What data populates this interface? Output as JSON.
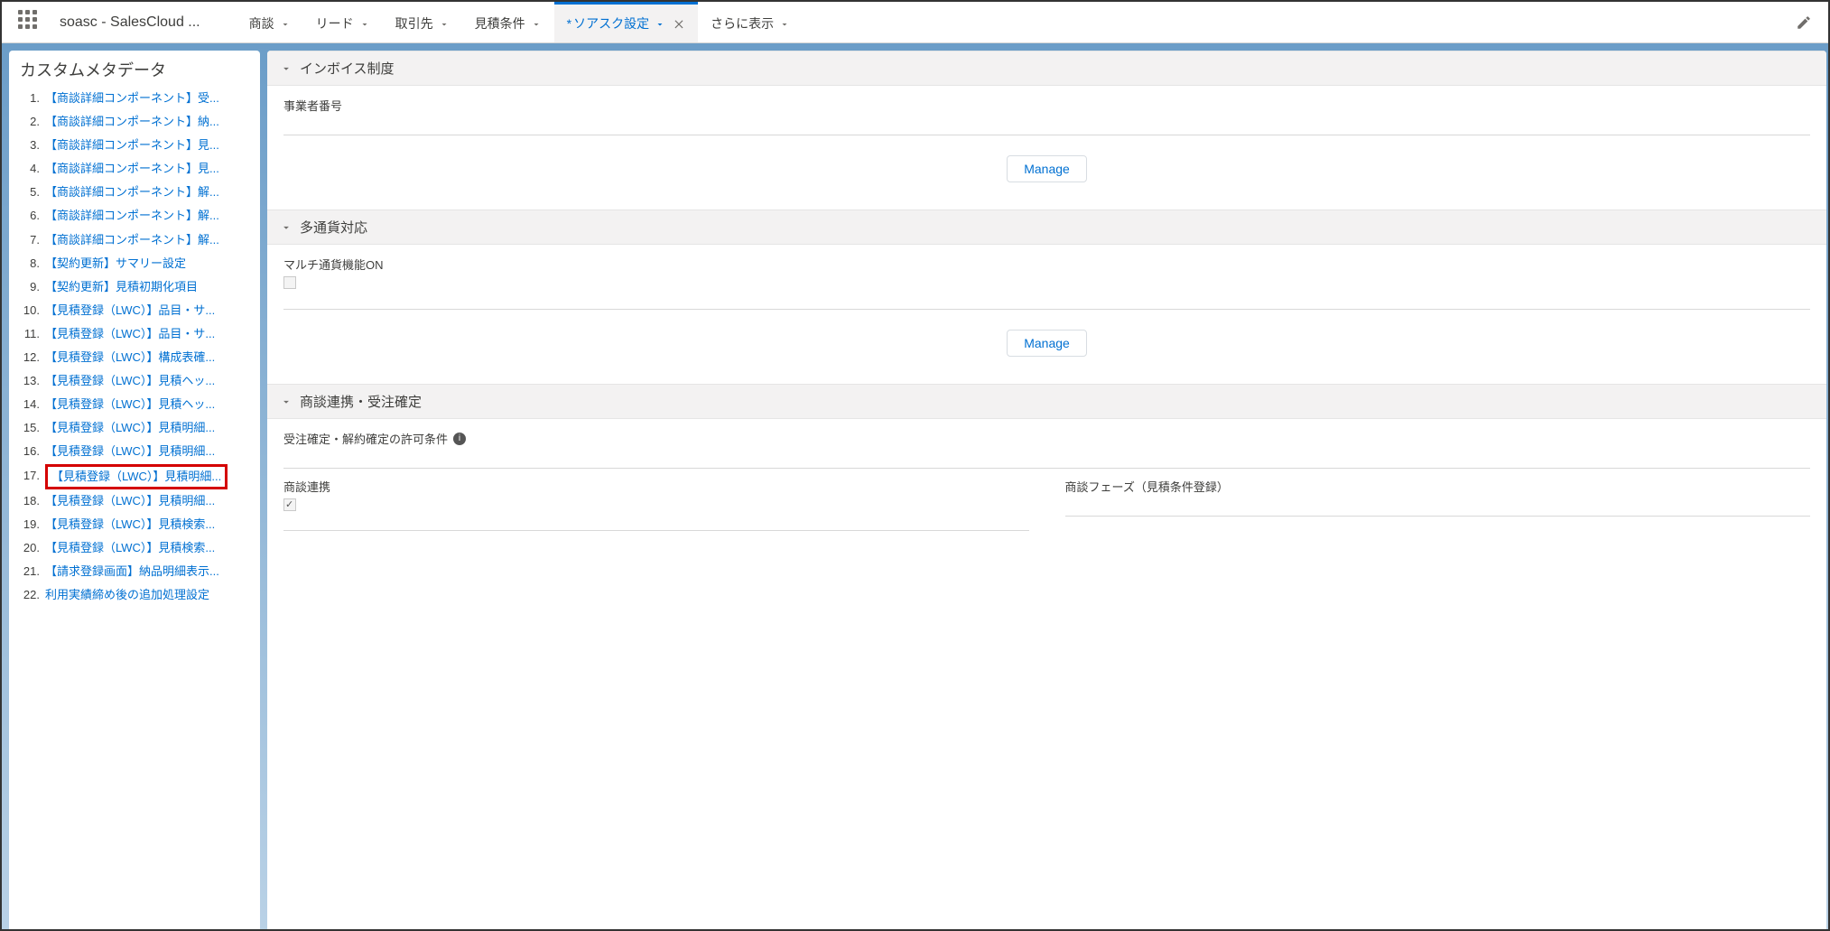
{
  "header": {
    "app_name": "soasc - SalesCloud ...",
    "tabs": [
      {
        "label": "商談"
      },
      {
        "label": "リード"
      },
      {
        "label": "取引先"
      },
      {
        "label": "見積条件"
      },
      {
        "label": "ソアスク設定",
        "active": true,
        "closable": true
      },
      {
        "label": "さらに表示",
        "more": true
      }
    ]
  },
  "sidebar": {
    "title": "カスタムメタデータ",
    "items": [
      "【商談詳細コンポーネント】受...",
      "【商談詳細コンポーネント】納...",
      "【商談詳細コンポーネント】見...",
      "【商談詳細コンポーネント】見...",
      "【商談詳細コンポーネント】解...",
      "【商談詳細コンポーネント】解...",
      "【商談詳細コンポーネント】解...",
      "【契約更新】サマリー設定",
      "【契約更新】見積初期化項目",
      "【見積登録（LWC）】品目・サ...",
      "【見積登録（LWC）】品目・サ...",
      "【見積登録（LWC）】構成表確...",
      "【見積登録（LWC）】見積ヘッ...",
      "【見積登録（LWC）】見積ヘッ...",
      "【見積登録（LWC）】見積明細...",
      "【見積登録（LWC）】見積明細...",
      "【見積登録（LWC）】見積明細...",
      "【見積登録（LWC）】見積明細...",
      "【見積登録（LWC）】見積検索...",
      "【見積登録（LWC）】見積検索...",
      "【請求登録画面】納品明細表示...",
      "利用実績締め後の追加処理設定"
    ],
    "highlighted_index": 16
  },
  "main": {
    "manage_label": "Manage",
    "sections": [
      {
        "title": "インボイス制度",
        "fields": [
          {
            "label": "事業者番号",
            "type": "text"
          }
        ],
        "has_manage": true
      },
      {
        "title": "多通貨対応",
        "fields": [
          {
            "label": "マルチ通貨機能ON",
            "type": "checkbox",
            "checked": false
          }
        ],
        "has_manage": true
      },
      {
        "title": "商談連携・受注確定",
        "fields_top": [
          {
            "label": "受注確定・解約確定の許可条件",
            "info": true
          }
        ],
        "cols": [
          {
            "label": "商談連携",
            "type": "checkbox",
            "checked": true
          },
          {
            "label": "商談フェーズ（見積条件登録）",
            "type": "text"
          }
        ]
      }
    ]
  }
}
